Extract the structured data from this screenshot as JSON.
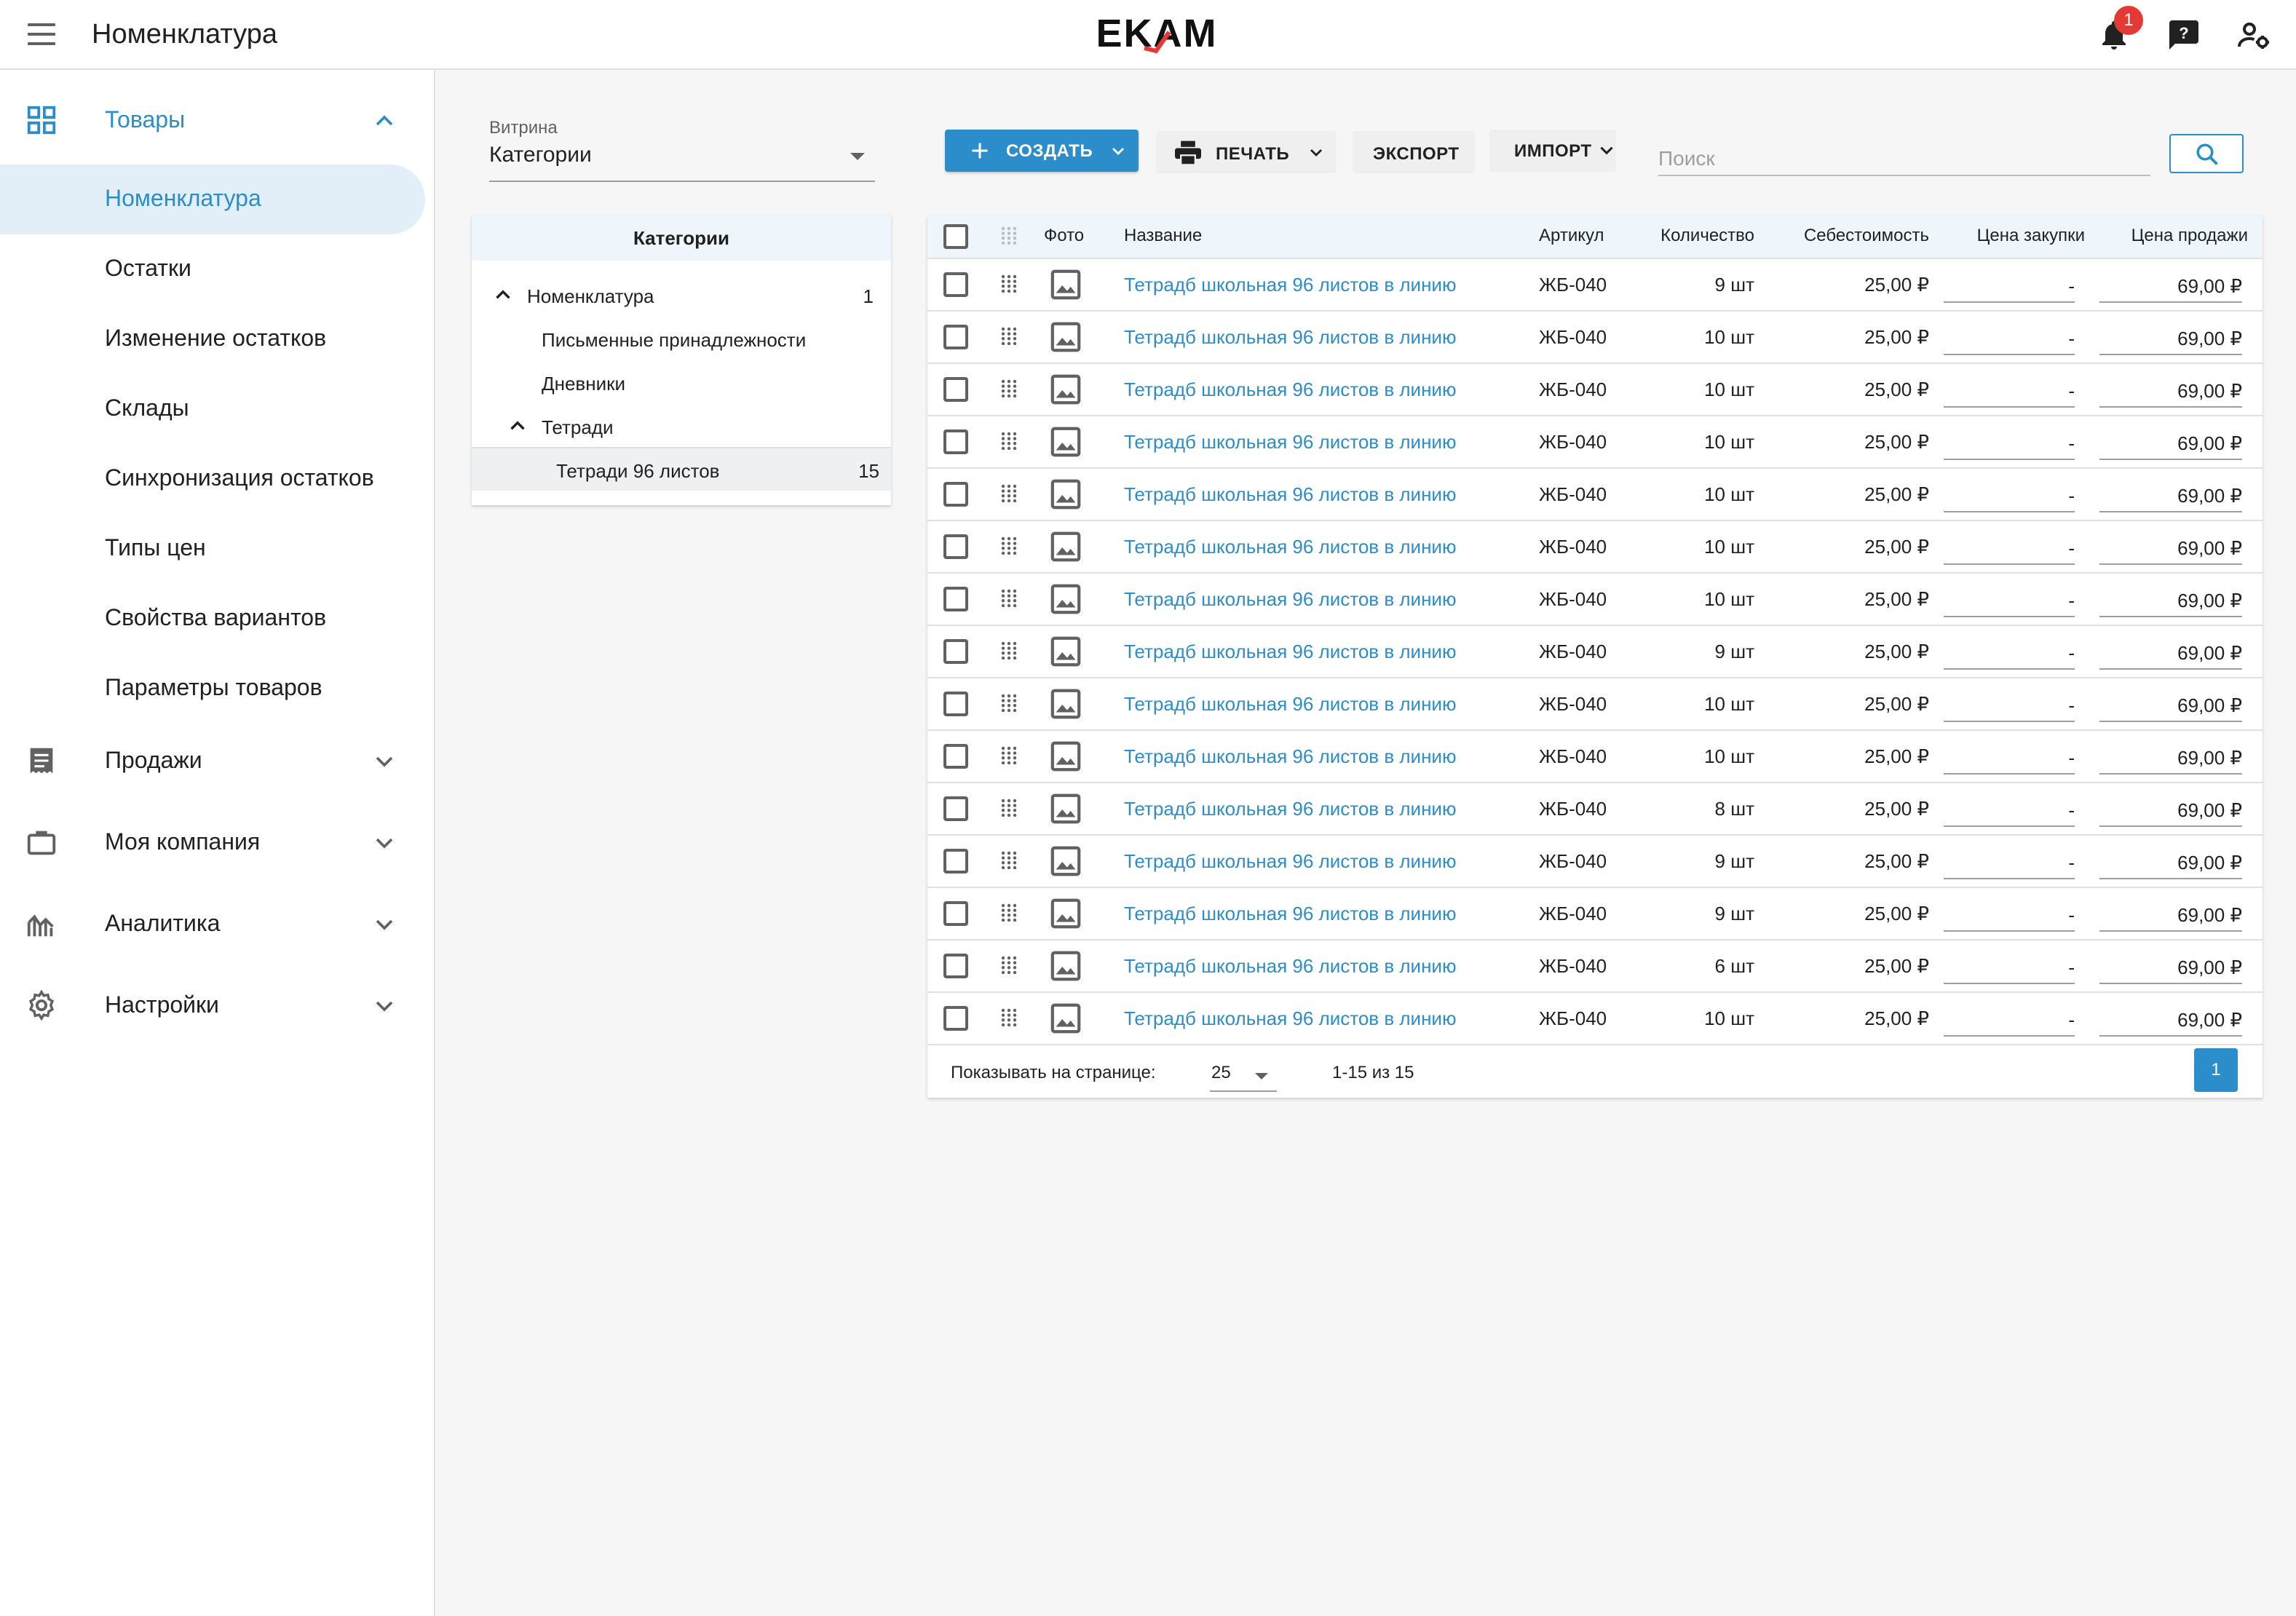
{
  "header": {
    "title": "Номенклатура",
    "logo_text": "EKAM",
    "notification_count": "1",
    "icons": [
      "menu-icon",
      "bell-icon",
      "help-icon",
      "user-settings-icon"
    ]
  },
  "sidebar": {
    "sections": [
      {
        "label": "Товары",
        "icon": "grid-icon",
        "expanded": true
      },
      {
        "label": "Продажи",
        "icon": "receipt-icon",
        "expanded": false
      },
      {
        "label": "Моя компания",
        "icon": "briefcase-icon",
        "expanded": false
      },
      {
        "label": "Аналитика",
        "icon": "analytics-icon",
        "expanded": false
      },
      {
        "label": "Настройки",
        "icon": "gear-icon",
        "expanded": false
      }
    ],
    "sub_items": [
      {
        "label": "Номенклатура",
        "active": true
      },
      {
        "label": "Остатки"
      },
      {
        "label": "Изменение остатков"
      },
      {
        "label": "Склады"
      },
      {
        "label": "Синхронизация остатков"
      },
      {
        "label": "Типы цен"
      },
      {
        "label": "Свойства вариантов"
      },
      {
        "label": "Параметры товаров"
      }
    ]
  },
  "vitrina": {
    "label": "Витрина",
    "value": "Категории"
  },
  "categories": {
    "title": "Категории",
    "items": [
      {
        "label": "Номенклатура",
        "count": "1",
        "expanded": true
      },
      {
        "label": "Письменные принадлежности",
        "count": ""
      },
      {
        "label": "Дневники",
        "count": ""
      },
      {
        "label": "Тетради",
        "count": "",
        "expanded": true
      },
      {
        "label": "Тетради 96 листов",
        "count": "15",
        "selected": true
      }
    ]
  },
  "toolbar": {
    "create_label": "СОЗДАТЬ",
    "print_label": "ПЕЧАТЬ",
    "export_label": "ЭКСПОРТ",
    "import_label": "ИМПОРТ",
    "search_placeholder": "Поиск",
    "search_value": ""
  },
  "table": {
    "columns": {
      "photo": "Фото",
      "name": "Название",
      "sku": "Артикул",
      "qty": "Количество",
      "cost": "Себестоимость",
      "purchase": "Цена закупки",
      "sale": "Цена продажи"
    },
    "rows": [
      {
        "name": "Тетрадб школьная 96 листов в линию",
        "sku": "ЖБ-040",
        "qty": "9 шт",
        "cost": "25,00 ₽",
        "purchase": "-",
        "sale": "69,00 ₽"
      },
      {
        "name": "Тетрадб школьная 96 листов в линию",
        "sku": "ЖБ-040",
        "qty": "10 шт",
        "cost": "25,00 ₽",
        "purchase": "-",
        "sale": "69,00 ₽"
      },
      {
        "name": "Тетрадб школьная 96 листов в линию",
        "sku": "ЖБ-040",
        "qty": "10 шт",
        "cost": "25,00 ₽",
        "purchase": "-",
        "sale": "69,00 ₽"
      },
      {
        "name": "Тетрадб школьная 96 листов в линию",
        "sku": "ЖБ-040",
        "qty": "10 шт",
        "cost": "25,00 ₽",
        "purchase": "-",
        "sale": "69,00 ₽"
      },
      {
        "name": "Тетрадб школьная 96 листов в линию",
        "sku": "ЖБ-040",
        "qty": "10 шт",
        "cost": "25,00 ₽",
        "purchase": "-",
        "sale": "69,00 ₽"
      },
      {
        "name": "Тетрадб школьная 96 листов в линию",
        "sku": "ЖБ-040",
        "qty": "10 шт",
        "cost": "25,00 ₽",
        "purchase": "-",
        "sale": "69,00 ₽"
      },
      {
        "name": "Тетрадб школьная 96 листов в линию",
        "sku": "ЖБ-040",
        "qty": "10 шт",
        "cost": "25,00 ₽",
        "purchase": "-",
        "sale": "69,00 ₽"
      },
      {
        "name": "Тетрадб школьная 96 листов в линию",
        "sku": "ЖБ-040",
        "qty": "9 шт",
        "cost": "25,00 ₽",
        "purchase": "-",
        "sale": "69,00 ₽"
      },
      {
        "name": "Тетрадб школьная 96 листов в линию",
        "sku": "ЖБ-040",
        "qty": "10 шт",
        "cost": "25,00 ₽",
        "purchase": "-",
        "sale": "69,00 ₽"
      },
      {
        "name": "Тетрадб школьная 96 листов в линию",
        "sku": "ЖБ-040",
        "qty": "10 шт",
        "cost": "25,00 ₽",
        "purchase": "-",
        "sale": "69,00 ₽"
      },
      {
        "name": "Тетрадб школьная 96 листов в линию",
        "sku": "ЖБ-040",
        "qty": "8 шт",
        "cost": "25,00 ₽",
        "purchase": "-",
        "sale": "69,00 ₽"
      },
      {
        "name": "Тетрадб школьная 96 листов в линию",
        "sku": "ЖБ-040",
        "qty": "9 шт",
        "cost": "25,00 ₽",
        "purchase": "-",
        "sale": "69,00 ₽"
      },
      {
        "name": "Тетрадб школьная 96 листов в линию",
        "sku": "ЖБ-040",
        "qty": "9 шт",
        "cost": "25,00 ₽",
        "purchase": "-",
        "sale": "69,00 ₽"
      },
      {
        "name": "Тетрадб школьная 96 листов в линию",
        "sku": "ЖБ-040",
        "qty": "6 шт",
        "cost": "25,00 ₽",
        "purchase": "-",
        "sale": "69,00 ₽"
      },
      {
        "name": "Тетрадб школьная 96 листов в линию",
        "sku": "ЖБ-040",
        "qty": "10 шт",
        "cost": "25,00 ₽",
        "purchase": "-",
        "sale": "69,00 ₽"
      }
    ]
  },
  "pagination": {
    "per_page_label": "Показывать на странице:",
    "per_page_value": "25",
    "range_text": "1-15 из 15",
    "current_page": "1"
  },
  "colors": {
    "accent": "#2b8dc9",
    "header_row": "#eef5fb",
    "active_nav": "#e3eff8",
    "badge": "#e53935"
  }
}
